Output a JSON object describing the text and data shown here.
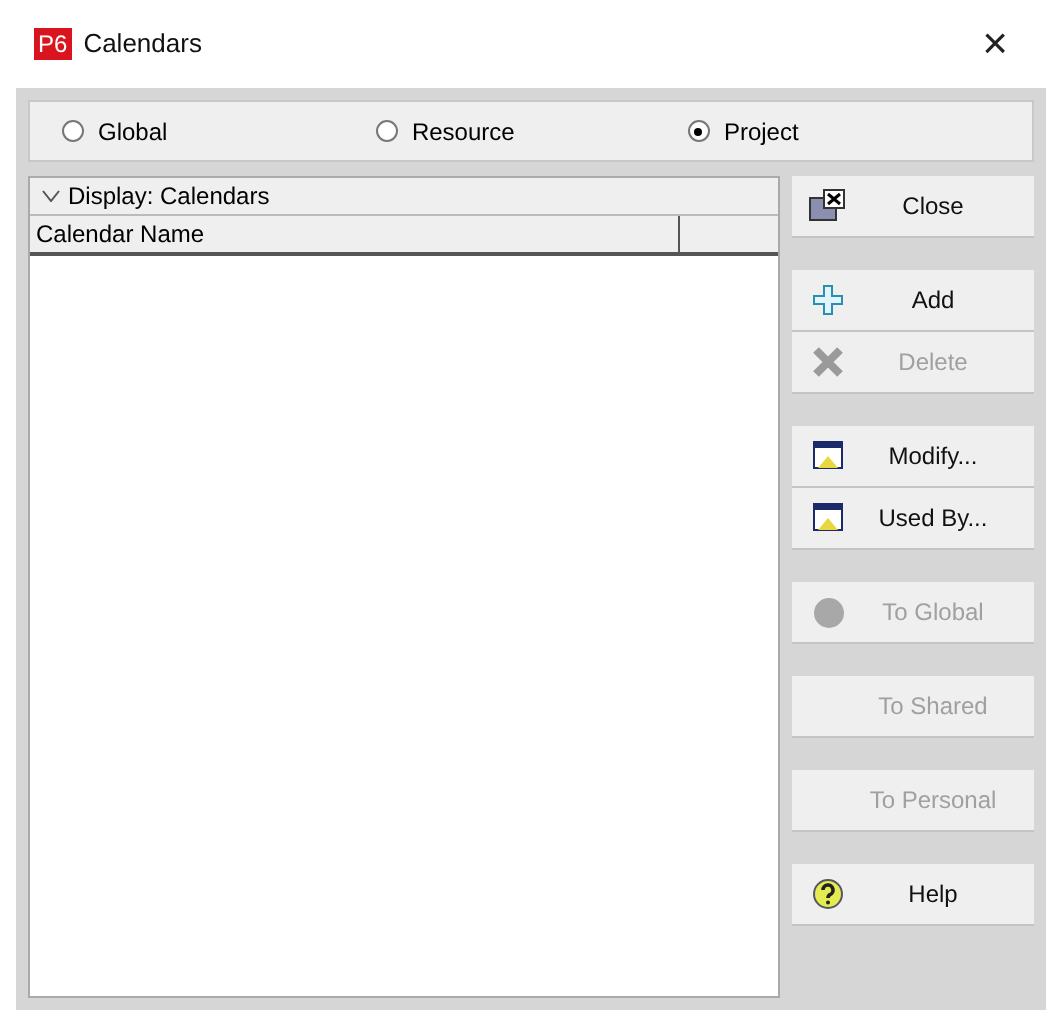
{
  "window": {
    "title": "Calendars",
    "logo": "P6",
    "close": "×"
  },
  "scope_options": [
    {
      "label": "Global",
      "selected": false
    },
    {
      "label": "Resource",
      "selected": false
    },
    {
      "label": "Project",
      "selected": true
    }
  ],
  "list": {
    "display_label": "Display: Calendars",
    "columns": [
      "Calendar Name"
    ]
  },
  "buttons": [
    {
      "label": "Close",
      "kind": "close",
      "disabled": false,
      "gap_before": false
    },
    {
      "label": "Add",
      "kind": "add",
      "disabled": false,
      "gap_before": true
    },
    {
      "label": "Delete",
      "kind": "delete",
      "disabled": true,
      "gap_before": false
    },
    {
      "label": "Modify...",
      "kind": "window",
      "disabled": false,
      "gap_before": true
    },
    {
      "label": "Used By...",
      "kind": "window",
      "disabled": false,
      "gap_before": false
    },
    {
      "label": "To Global",
      "kind": "circle",
      "disabled": true,
      "gap_before": true
    },
    {
      "label": "To Shared",
      "kind": "none",
      "disabled": true,
      "gap_before": true
    },
    {
      "label": "To Personal",
      "kind": "none",
      "disabled": true,
      "gap_before": true
    },
    {
      "label": "Help",
      "kind": "help",
      "disabled": false,
      "gap_before": true
    }
  ]
}
